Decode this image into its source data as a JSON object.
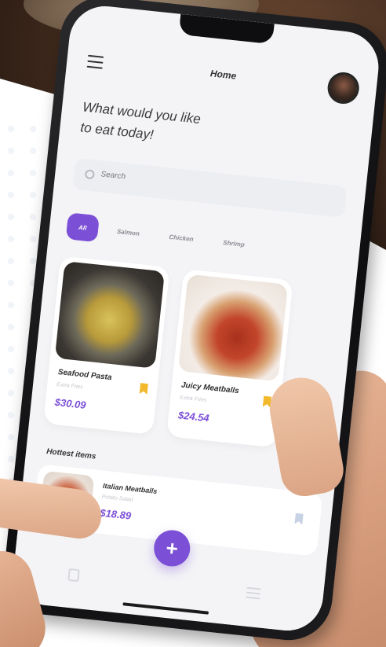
{
  "header": {
    "title": "Home"
  },
  "greeting": {
    "line1": "What would you like",
    "line2": "to eat today!"
  },
  "search": {
    "placeholder": "Search"
  },
  "categories": [
    {
      "label": "All",
      "active": true
    },
    {
      "label": "Salmon",
      "active": false
    },
    {
      "label": "Chicken",
      "active": false
    },
    {
      "label": "Shrimp",
      "active": false
    }
  ],
  "featured": [
    {
      "name": "Seafood Pasta",
      "subtitle": "Extra Fries",
      "price": "$30.09",
      "bookmark_color": "#f1b92b"
    },
    {
      "name": "Juicy Meatballs",
      "subtitle": "Extra Fries",
      "price": "$24.54",
      "bookmark_color": "#f1b92b"
    }
  ],
  "hottest": {
    "title": "Hottest items",
    "items": [
      {
        "name": "Italian Meatballs",
        "subtitle": "Potato Salad",
        "price": "$18.89"
      }
    ]
  },
  "fab": {
    "label": "+"
  },
  "colors": {
    "accent": "#7b4fd6",
    "bookmark": "#f1b92b",
    "screen_bg": "#f4f4f6"
  },
  "icons": {
    "menu": "menu-icon",
    "search": "search-icon",
    "bookmark": "bookmark-icon",
    "add": "plus-icon"
  }
}
